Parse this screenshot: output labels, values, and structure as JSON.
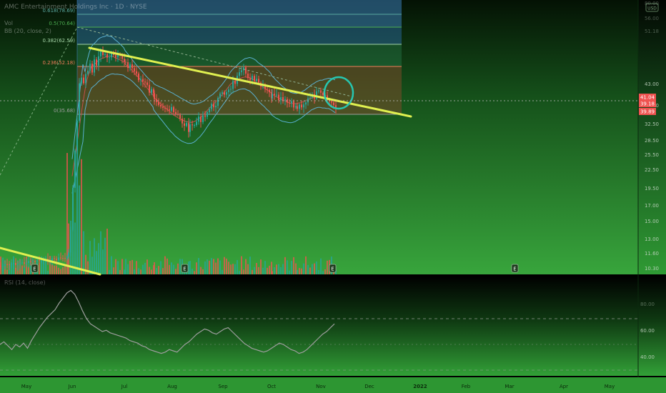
{
  "header": {
    "symbol_line": "AMC Entertainment Holdings Inc · 1D · NYSE",
    "sub_line_1": "Vol",
    "sub_line_2": "BB (20, close, 2)"
  },
  "currency_badge": "USD",
  "rsi_label": "RSI (14, close)",
  "earnings_marker": "E",
  "chart_data": [
    {
      "type": "candlestick",
      "pane": "price",
      "x_ticks": [
        "May",
        "Jun",
        "Jul",
        "Aug",
        "Sep",
        "Oct",
        "Nov",
        "Dec",
        "2022",
        "Feb",
        "Mar",
        "Apr",
        "May"
      ],
      "y_ticks": [
        "80.00",
        "56.00",
        "51.18",
        "43.00",
        "38.50",
        "32.50",
        "28.50",
        "25.50",
        "22.50",
        "19.50",
        "17.00",
        "15.00",
        "13.00",
        "11.60",
        "10.30"
      ],
      "price_labels": [
        "41.04",
        "39.18",
        "39.89"
      ],
      "fib_levels": [
        {
          "ratio": "0.618",
          "price": "78.69",
          "label": "0.618(78.69)",
          "color": "#5aa9a0"
        },
        {
          "ratio": "0.5",
          "price": "70.64",
          "label": "0.5(70.64)",
          "color": "#4caf50"
        },
        {
          "ratio": "0.382",
          "price": "62.59",
          "label": "0.382(62.59)",
          "color": "#a5d6a7"
        },
        {
          "ratio": "0.236",
          "price": "52.18",
          "label": "0.236(52.18)",
          "color": "#f07c5a"
        },
        {
          "ratio": "0",
          "price": "35.68",
          "label": "0(35.68)",
          "color": "#9e9e9e"
        }
      ],
      "trendline_color": "#e0f050",
      "up_color": "#26a69a",
      "down_color": "#ef5350",
      "grid": false
    },
    {
      "type": "line",
      "pane": "rsi",
      "name": "RSI (14, close)",
      "y_ticks": [
        "80.00",
        "60.00",
        "40.00"
      ],
      "x_ticks": [
        "May",
        "Jun",
        "Jul",
        "Aug",
        "Sep",
        "Oct",
        "Nov",
        "Dec",
        "2022",
        "Feb",
        "Mar",
        "Apr",
        "May"
      ],
      "values": [
        50,
        52,
        49,
        46,
        50,
        48,
        51,
        47,
        53,
        58,
        63,
        67,
        71,
        74,
        77,
        82,
        86,
        90,
        92,
        89,
        83,
        76,
        70,
        66,
        64,
        62,
        60,
        61,
        59,
        58,
        57,
        56,
        55,
        53,
        52,
        51,
        49,
        48,
        46,
        45,
        44,
        43,
        44,
        46,
        45,
        44,
        47,
        50,
        52,
        55,
        58,
        60,
        62,
        61,
        59,
        58,
        60,
        62,
        63,
        60,
        57,
        54,
        51,
        49,
        47,
        46,
        45,
        44,
        45,
        47,
        49,
        51,
        50,
        48,
        46,
        45,
        43,
        44,
        46,
        49,
        52,
        55,
        58,
        60,
        63,
        66
      ],
      "line_color": "#9e9e9e"
    }
  ]
}
